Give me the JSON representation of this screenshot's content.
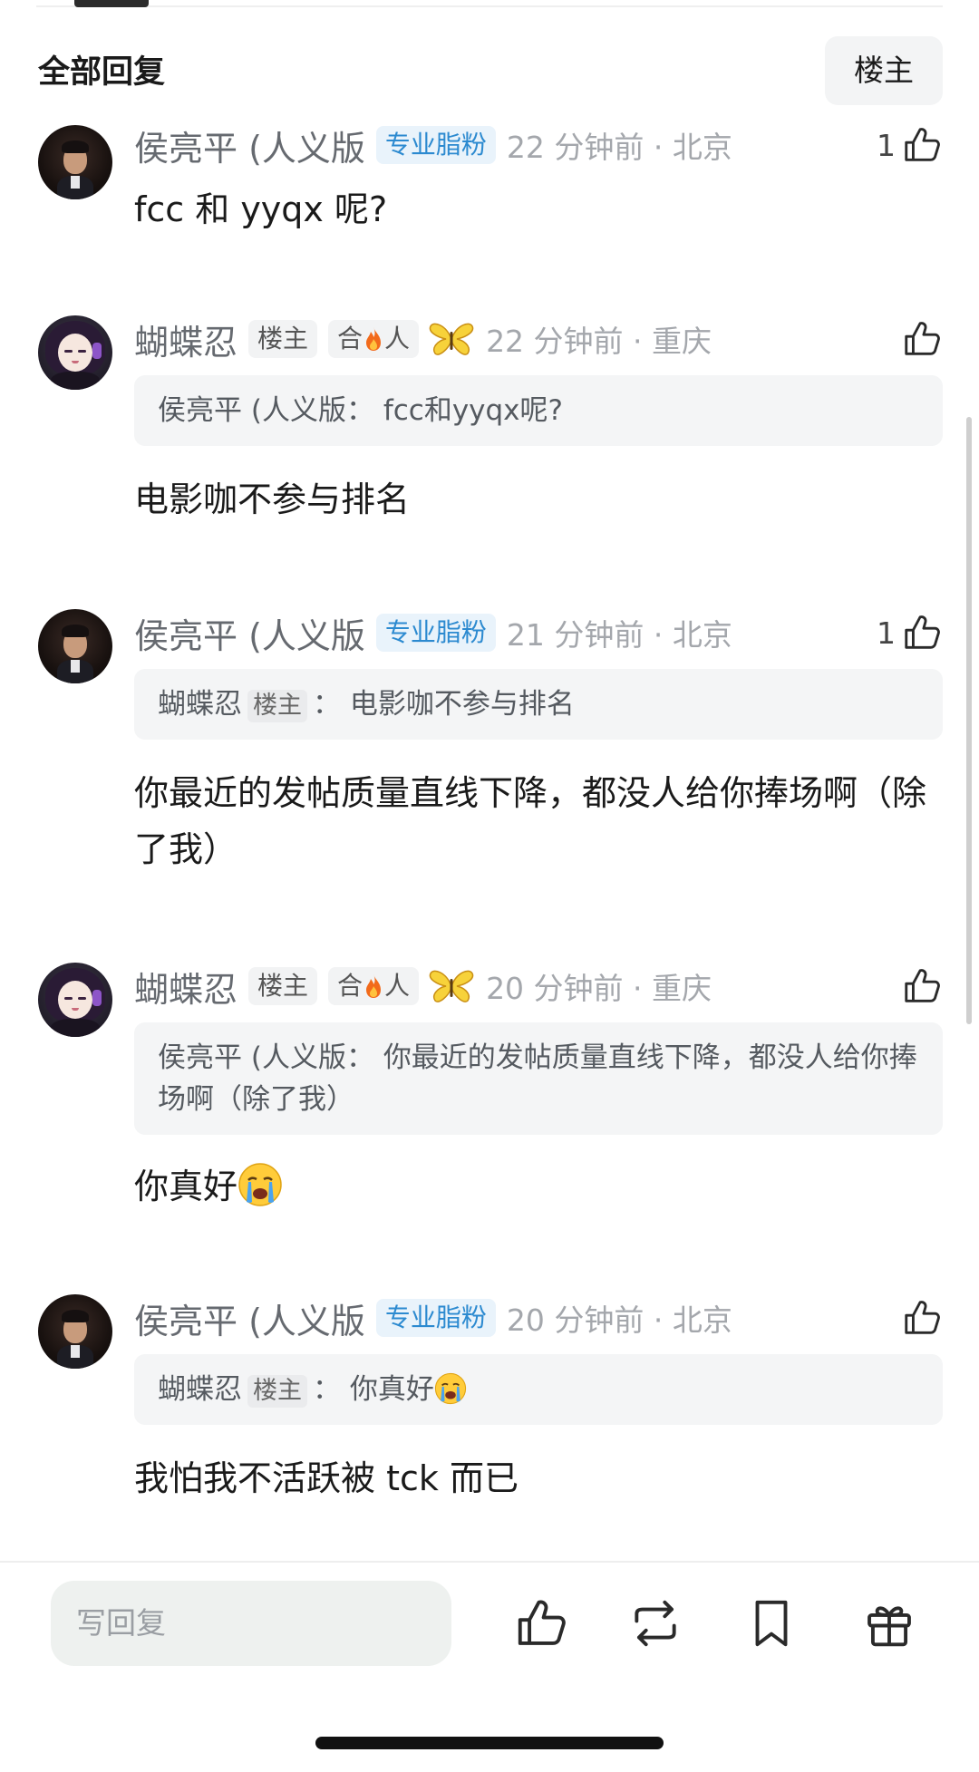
{
  "header": {
    "title": "全部回复",
    "op_filter": "楼主"
  },
  "comments": [
    {
      "username": "侯亮平 (人义版",
      "badges": [
        "专业脂粉"
      ],
      "time_location": "22 分钟前 · 北京",
      "like_count": "1",
      "body": "fcc 和 yyqx 呢?"
    },
    {
      "username": "蝴蝶忍",
      "badges": [
        "楼主",
        "合",
        "人"
      ],
      "time_location": "22 分钟前 · 重庆",
      "like_count": "",
      "quote": {
        "author": "侯亮平 (人义版",
        "sep": "：",
        "text": "fcc和yyqx呢?"
      },
      "body": "电影咖不参与排名"
    },
    {
      "username": "侯亮平 (人义版",
      "badges": [
        "专业脂粉"
      ],
      "time_location": "21 分钟前 · 北京",
      "like_count": "1",
      "quote": {
        "author": "蝴蝶忍",
        "badge": "楼主",
        "sep": "：",
        "text": "电影咖不参与排名"
      },
      "body": "你最近的发帖质量直线下降，都没人给你捧场啊（除了我）"
    },
    {
      "username": "蝴蝶忍",
      "badges": [
        "楼主",
        "合",
        "人"
      ],
      "time_location": "20 分钟前 · 重庆",
      "like_count": "",
      "quote": {
        "author": "侯亮平 (人义版",
        "sep": "：",
        "text": "你最近的发帖质量直线下降，都没人给你捧场啊（除了我）"
      },
      "body": "你真好"
    },
    {
      "username": "侯亮平 (人义版",
      "badges": [
        "专业脂粉"
      ],
      "time_location": "20 分钟前 · 北京",
      "like_count": "",
      "quote": {
        "author": "蝴蝶忍",
        "badge": "楼主",
        "sep": "：",
        "text": "你真好"
      },
      "body": "我怕我不活跃被 tck 而已"
    }
  ],
  "bottom_bar": {
    "reply_placeholder": "写回复",
    "icons": [
      "thumbs-up-icon",
      "repost-icon",
      "bookmark-icon",
      "gift-icon"
    ]
  },
  "colors": {
    "username": "#666a70",
    "badge_blue": "#2c8ad0",
    "time": "#a4a7ac",
    "quote_bg": "#f4f5f6"
  }
}
